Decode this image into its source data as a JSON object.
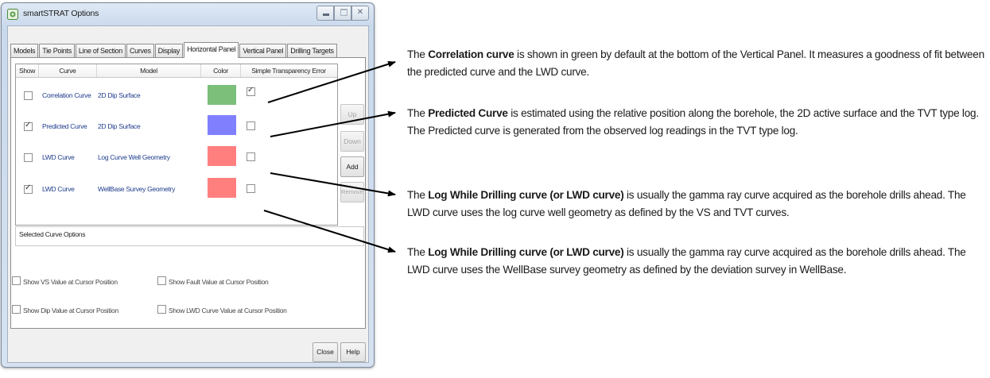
{
  "window": {
    "title": "smartSTRAT Options",
    "caption_close": "✕"
  },
  "tabs": [
    "Models",
    "Tie Points",
    "Line of Section",
    "Curves",
    "Display",
    "Horizontal Panel",
    "Vertical Panel",
    "Drilling Targets"
  ],
  "active_tab": "Horizontal Panel",
  "grid": {
    "columns": [
      "Show",
      "Curve",
      "Model",
      "Color",
      "Simple Transparency Error"
    ],
    "rows": [
      {
        "show": false,
        "curve": "Correlation Curve",
        "model": "2D Dip Surface",
        "color": "#7bbf7b",
        "transparency": true
      },
      {
        "show": true,
        "curve": "Predicted Curve",
        "model": "2D Dip Surface",
        "color": "#8080ff",
        "transparency": false
      },
      {
        "show": false,
        "curve": "LWD Curve",
        "model": "Log Curve Well Geometry",
        "color": "#ff7f7f",
        "transparency": false
      },
      {
        "show": true,
        "curve": "LWD Curve",
        "model": "WellBase Survey Geometry",
        "color": "#ff7f7f",
        "transparency": false
      }
    ]
  },
  "side_buttons": {
    "up": "Up",
    "down": "Down",
    "add": "Add",
    "remove": "Remove"
  },
  "selected_curve_options_label": "Selected Curve Options",
  "options": {
    "vs_value": "Show VS Value at Cursor Position",
    "fault_value": "Show Fault Value at Cursor Position",
    "dip_value": "Show Dip Value at Cursor Position",
    "lwd_value": "Show LWD Curve Value at Cursor Position"
  },
  "dialog_buttons": {
    "close": "Close",
    "help": "Help"
  },
  "descriptions": [
    {
      "pre": "The ",
      "bold": "Correlation curve",
      "post": " is shown in green by default at the bottom of the Vertical Panel.  It measures a goodness of fit between the predicted curve and the LWD curve."
    },
    {
      "pre": "The ",
      "bold": "Predicted Curve",
      "post": " is estimated using the relative position along the borehole, the 2D active surface and the TVT type log.  The Predicted curve is generated from the observed log readings in the TVT type log."
    },
    {
      "pre": "The ",
      "bold": "Log While Drilling curve (or LWD curve)",
      "post": " is usually the gamma ray curve acquired as the borehole drills ahead.  The LWD curve uses the log curve well geometry as defined by the VS and TVT curves."
    },
    {
      "pre": "The ",
      "bold": "Log While Drilling curve (or LWD curve)",
      "post": " is usually the gamma ray curve acquired as the borehole drills ahead.  The LWD curve uses the WellBase survey geometry as defined by the deviation survey in WellBase."
    }
  ]
}
